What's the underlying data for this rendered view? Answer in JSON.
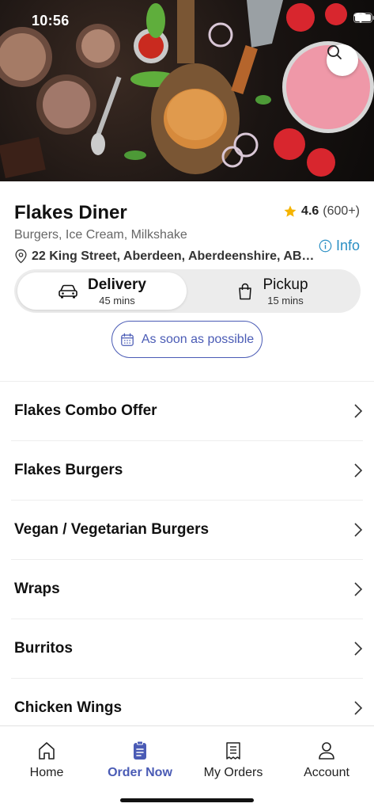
{
  "status_bar": {
    "time": "10:56"
  },
  "hero": {
    "search_icon": "search-icon"
  },
  "restaurant": {
    "name": "Flakes Diner",
    "rating": "4.6",
    "rating_count": "(600+)",
    "cuisines": "Burgers, Ice Cream, Milkshake",
    "address": "22 King Street, Aberdeen, Aberdeenshire, AB…",
    "info_label": "Info"
  },
  "fulfilment": {
    "delivery": {
      "label": "Delivery",
      "time": "45 mins",
      "selected": true
    },
    "pickup": {
      "label": "Pickup",
      "time": "15 mins",
      "selected": false
    }
  },
  "schedule": {
    "label": "As soon as possible"
  },
  "menu": {
    "categories": [
      {
        "label": "Flakes Combo Offer"
      },
      {
        "label": "Flakes Burgers"
      },
      {
        "label": "Vegan / Vegetarian Burgers"
      },
      {
        "label": "Wraps"
      },
      {
        "label": "Burritos"
      },
      {
        "label": "Chicken Wings"
      }
    ]
  },
  "bottom_nav": {
    "items": [
      {
        "label": "Home",
        "icon": "home-icon"
      },
      {
        "label": "Order Now",
        "icon": "order-icon",
        "active": true
      },
      {
        "label": "My Orders",
        "icon": "receipt-icon"
      },
      {
        "label": "Account",
        "icon": "user-icon"
      }
    ]
  },
  "colors": {
    "accent": "#4a5bb5",
    "link": "#2a8fc4",
    "star": "#f5b400"
  }
}
